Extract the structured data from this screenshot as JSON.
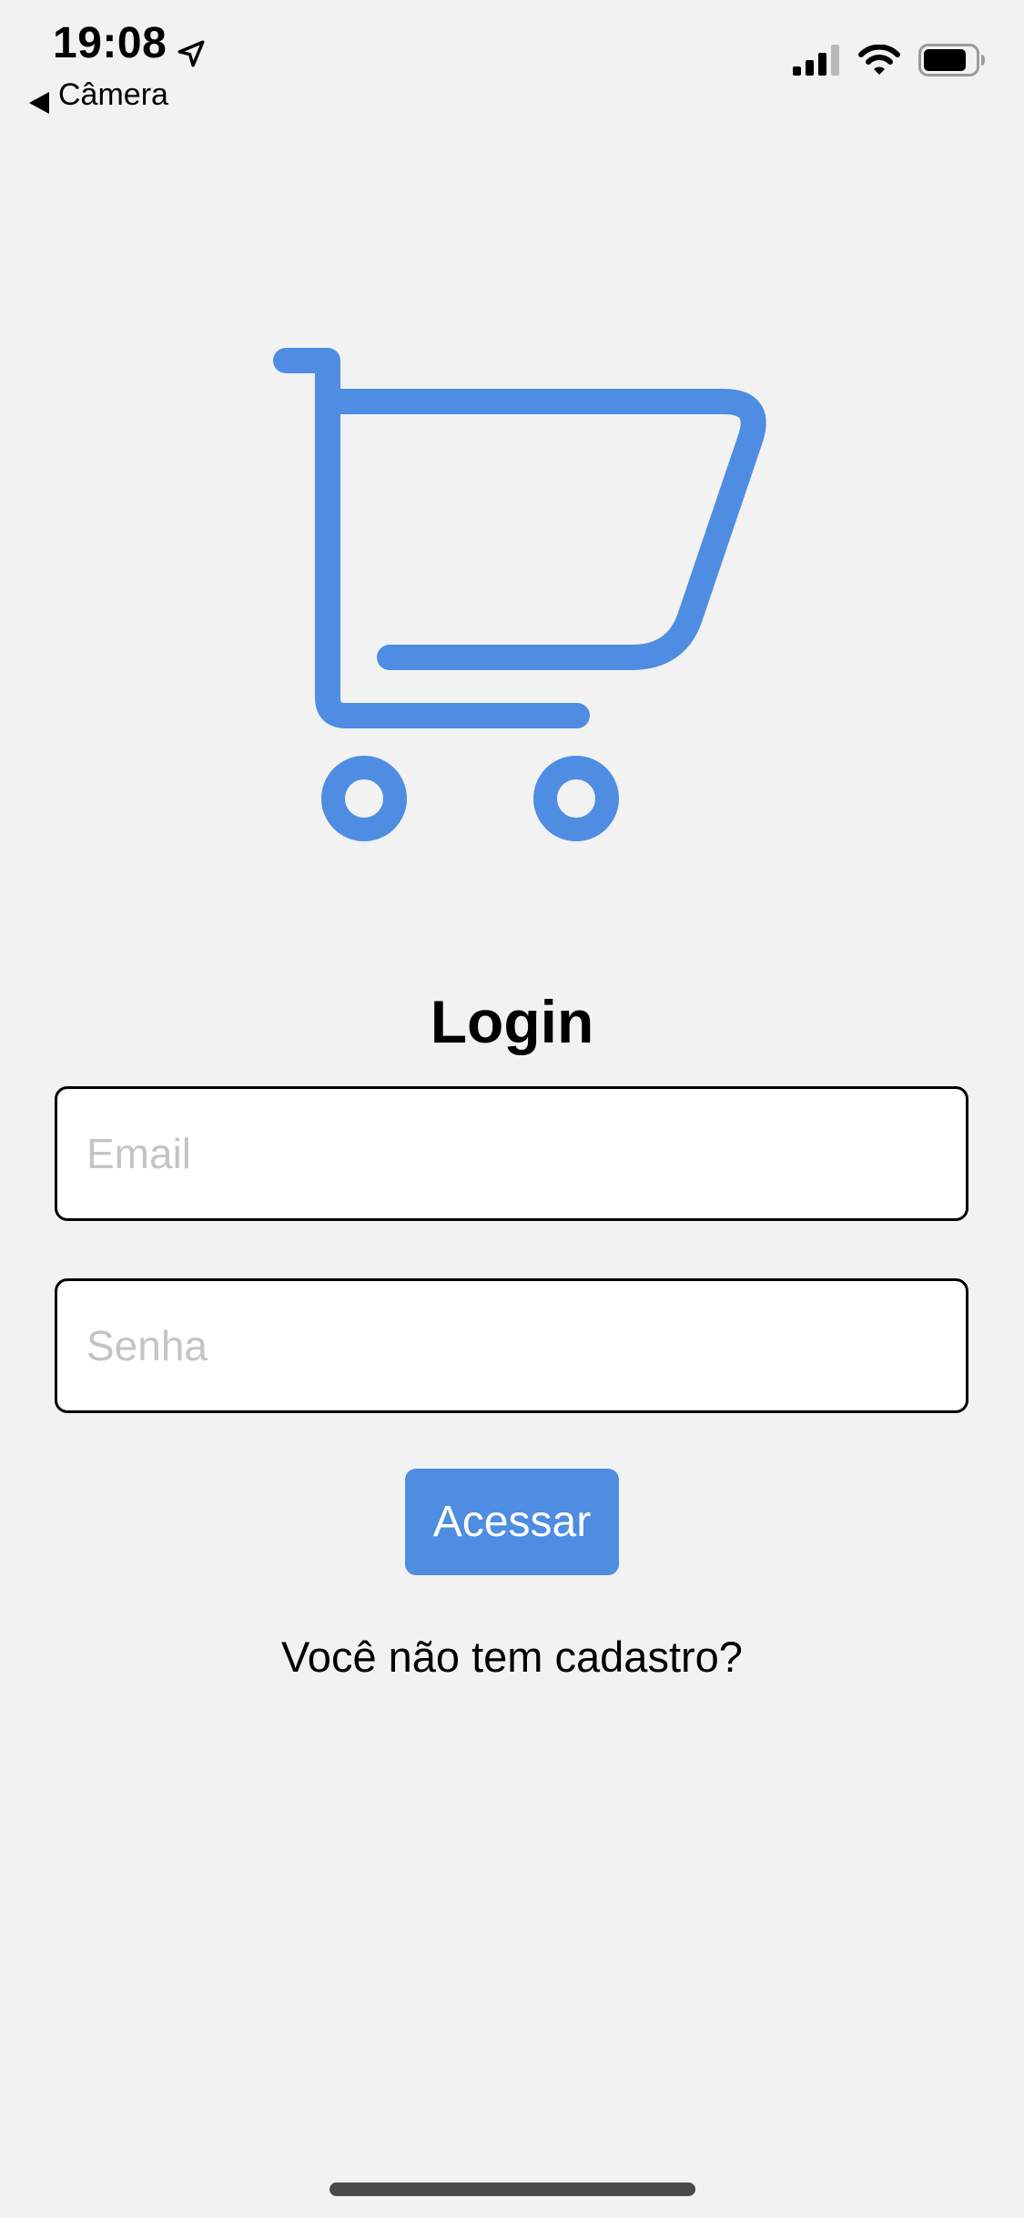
{
  "status_bar": {
    "time": "19:08",
    "back_label": "Câmera",
    "icons": [
      "location-arrow-icon",
      "cellular-signal-icon",
      "wifi-icon",
      "battery-icon"
    ],
    "battery_level": 0.8
  },
  "logo": {
    "icon": "shopping-cart-icon",
    "color": "#4e8de2"
  },
  "login": {
    "title": "Login",
    "email_placeholder": "Email",
    "email_value": "",
    "password_placeholder": "Senha",
    "password_value": "",
    "submit_label": "Acessar",
    "register_prompt": "Você não tem cadastro?"
  },
  "colors": {
    "background": "#f2f2f2",
    "accent": "#4e8de2",
    "input_border": "#000000",
    "placeholder": "#c4c4c6"
  }
}
